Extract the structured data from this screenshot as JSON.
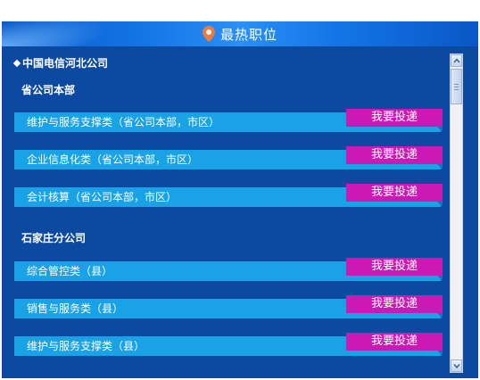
{
  "header": {
    "title": "最热职位",
    "icon": "location-pin-icon"
  },
  "tree": {
    "root_label": "中国电信河北公司",
    "groups": [
      {
        "name": "省公司本部",
        "jobs": [
          {
            "title": "维护与服务支撑类（省公司本部，市区）",
            "button": "我要投递"
          },
          {
            "title": "企业信息化类（省公司本部，市区）",
            "button": "我要投递"
          },
          {
            "title": "会计核算（省公司本部，市区）",
            "button": "我要投递"
          }
        ]
      },
      {
        "name": "石家庄分公司",
        "jobs": [
          {
            "title": "综合管控类（县）",
            "button": "我要投递"
          },
          {
            "title": "销售与服务类（县）",
            "button": "我要投递"
          },
          {
            "title": "维护与服务支撑类（县）",
            "button": "我要投递"
          }
        ]
      }
    ]
  },
  "colors": {
    "panel_bg": "#0b4aa0",
    "job_bar": "#1aa2e6",
    "apply_button": "#cc18b4",
    "pin": "#f07a3a"
  }
}
